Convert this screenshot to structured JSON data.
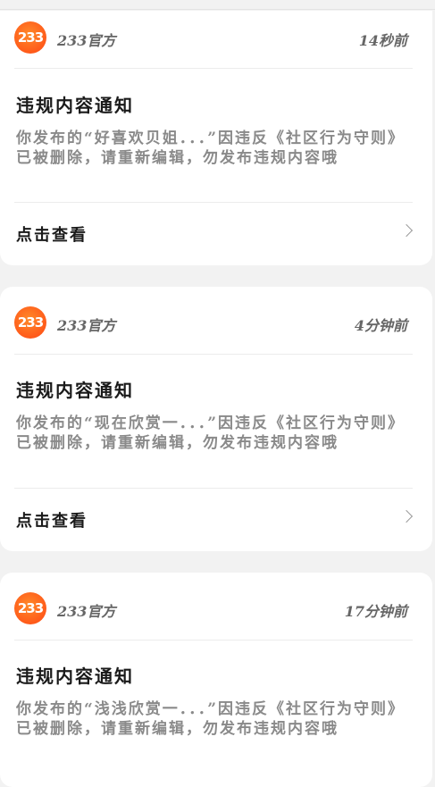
{
  "notifications": [
    {
      "logo_text": "233",
      "sender": "233官方",
      "time": "14秒前",
      "title": "违规内容通知",
      "body": "你发布的“好喜欢贝姐．．．”因违反《社区行为守则》已被删除，请重新编辑，勿发布违规内容哦",
      "action": "点击查看"
    },
    {
      "logo_text": "233",
      "sender": "233官方",
      "time": "4分钟前",
      "title": "违规内容通知",
      "body": "你发布的“现在欣赏一．．．”因违反《社区行为守则》已被删除，请重新编辑，勿发布违规内容哦",
      "action": "点击查看"
    },
    {
      "logo_text": "233",
      "sender": "233官方",
      "time": "17分钟前",
      "title": "违规内容通知",
      "body": "你发布的“浅浅欣赏一．．．”因违反《社区行为守则》已被删除，请重新编辑，勿发布违规内容哦"
    }
  ]
}
